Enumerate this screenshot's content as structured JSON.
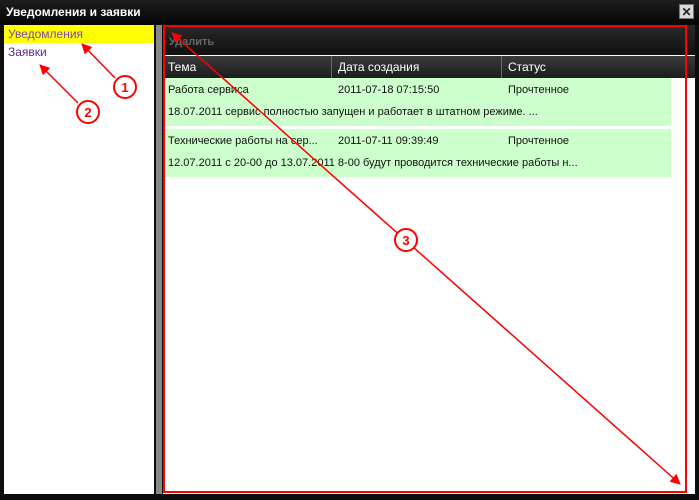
{
  "window": {
    "title": "Уведомления и заявки",
    "close_symbol": "✕"
  },
  "sidebar": {
    "items": [
      {
        "label": "Уведомления",
        "active": true
      },
      {
        "label": "Заявки",
        "active": false
      }
    ]
  },
  "toolbar": {
    "delete_label": "Удалить"
  },
  "table": {
    "columns": [
      "Тема",
      "Дата создания",
      "Статус"
    ],
    "rows": [
      {
        "subject": "Работа сервиса",
        "date": "2011-07-18 07:15:50",
        "status": "Прочтенное",
        "preview": "18.07.2011 сервис полностью запущен и работает в  штатном режиме. ..."
      },
      {
        "subject": "Технические работы на сер...",
        "date": "2011-07-11 09:39:49",
        "status": "Прочтенное",
        "preview": "12.07.2011 с 20-00 до 13.07.2011 8-00 будут проводится технические работы н..."
      }
    ]
  },
  "annotations": {
    "labels": [
      "1",
      "2",
      "3"
    ],
    "color": "#ff0000"
  },
  "colors": {
    "active_nav": "#ffff00",
    "row_bg": "#ccffcc",
    "header_bg": "#1c1c1c"
  }
}
